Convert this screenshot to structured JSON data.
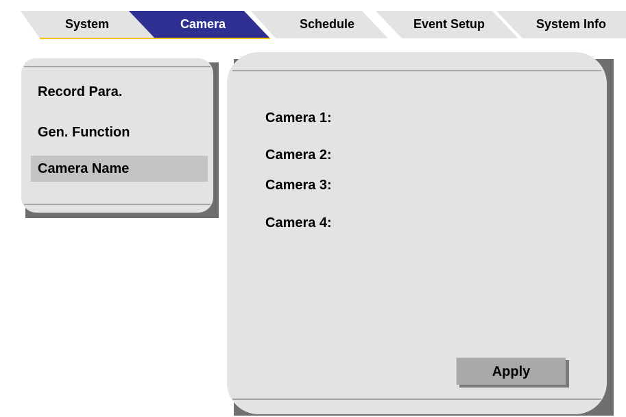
{
  "tabs": [
    {
      "label": "System",
      "active": false
    },
    {
      "label": "Camera",
      "active": true
    },
    {
      "label": "Schedule",
      "active": false
    },
    {
      "label": "Event Setup",
      "active": false
    },
    {
      "label": "System Info",
      "active": false
    }
  ],
  "sidebar": {
    "items": [
      {
        "label": "Record Para."
      },
      {
        "label": "Gen. Function"
      },
      {
        "label": "Camera Name",
        "selected": true
      }
    ]
  },
  "cameras": [
    {
      "label": "Camera 1:"
    },
    {
      "label": "Camera 2:"
    },
    {
      "label": "Camera 3:"
    },
    {
      "label": "Camera 4:"
    }
  ],
  "apply_label": "Apply",
  "colors": {
    "active_tab": "#2e3192",
    "active_tab_edge": "#f5c400",
    "tab": "#e3e3e3",
    "panel": "#e3e3e3",
    "panel_shadow": "#6f6f6f",
    "selected_item": "#c4c4c4",
    "button": "#a9a9a9"
  }
}
